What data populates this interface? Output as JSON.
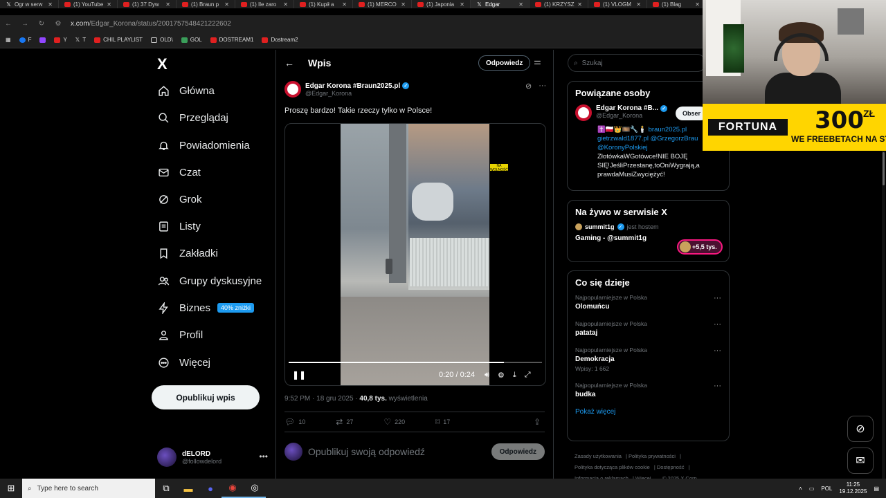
{
  "tabs": [
    {
      "label": "Ogr w serw",
      "icon": "x-icon",
      "active": false
    },
    {
      "label": "(1) YouTube",
      "icon": "youtube-icon",
      "active": false
    },
    {
      "label": "(1) 37 Dyw",
      "icon": "youtube-icon",
      "active": false
    },
    {
      "label": "(1) Braun p",
      "icon": "youtube-icon",
      "active": false
    },
    {
      "label": "(1) Ile zaro",
      "icon": "youtube-icon",
      "active": false
    },
    {
      "label": "(1) Kupił a",
      "icon": "youtube-icon",
      "active": false
    },
    {
      "label": "(1) MERCO",
      "icon": "youtube-icon",
      "active": false
    },
    {
      "label": "(1) Japonia",
      "icon": "youtube-icon",
      "active": false
    },
    {
      "label": "Edgar",
      "icon": "x-icon",
      "active": true
    },
    {
      "label": "(1) KRZYSZ",
      "icon": "youtube-icon",
      "active": false
    },
    {
      "label": "(1) VLOGM",
      "icon": "youtube-icon",
      "active": false
    },
    {
      "label": "(1) Blag",
      "icon": "youtube-icon",
      "active": false
    }
  ],
  "url": {
    "host": "x.com",
    "path": "/Edgar_Korona/status/2001757548421222602"
  },
  "bookmarks": [
    "F",
    "",
    "Y",
    "T",
    "CHIL PLAYLIST",
    "OLD\\",
    "GOL",
    "DOSTREAM1",
    "Dostream2"
  ],
  "sidebar": {
    "logo": "X",
    "items": [
      {
        "label": "Główna",
        "icon": "home-icon"
      },
      {
        "label": "Przeglądaj",
        "icon": "search-icon"
      },
      {
        "label": "Powiadomienia",
        "icon": "bell-icon"
      },
      {
        "label": "Czat",
        "icon": "mail-icon"
      },
      {
        "label": "Grok",
        "icon": "grok-icon"
      },
      {
        "label": "Listy",
        "icon": "list-icon"
      },
      {
        "label": "Zakładki",
        "icon": "bookmark-icon"
      },
      {
        "label": "Grupy dyskusyjne",
        "icon": "people-icon"
      },
      {
        "label": "Biznes",
        "icon": "bolt-icon",
        "badge": "40% zniżki"
      },
      {
        "label": "Profil",
        "icon": "person-icon"
      },
      {
        "label": "Więcej",
        "icon": "more-icon"
      }
    ],
    "post_button": "Opublikuj wpis",
    "account": {
      "name": "dELORD",
      "handle": "@followdelord"
    }
  },
  "main": {
    "header_title": "Wpis",
    "reply_button": "Odpowiedz",
    "author": {
      "name": "Edgar Korona #Braun2025.pl",
      "handle": "@Edgar_Korona"
    },
    "text": "Proszę bardzo! Takie rzeczy tylko w Polsce!",
    "video": {
      "time": "0:20 / 0:24",
      "progress": 0.85,
      "watermark": "w Polsce!",
      "sticker": "NA WOLNOŚĆ"
    },
    "meta": {
      "time": "9:52 PM · 18 gru 2025 · ",
      "views": "40,8 tys.",
      "views_label": "wyświetlenia"
    },
    "actions": {
      "replies": "10",
      "reposts": "27",
      "likes": "220",
      "bookmarks": "17"
    },
    "reply_placeholder": "Opublikuj swoją odpowiedź",
    "reply_submit": "Odpowiedz"
  },
  "right": {
    "search_placeholder": "Szukaj",
    "related": {
      "title": "Powiązane osoby",
      "name": "Edgar Korona #B...",
      "handle": "@Edgar_Korona",
      "follow": "Obser",
      "bio_flags": "✝️🇵🇱👑🎞️🔧🕯️",
      "bio_link1": "braun2025.pl",
      "bio_link2": "gietrzwald1877.pl @GrzegorzBrau",
      "bio_link3": "@KoronyPolskiej",
      "bio_text": "ZłotówkaWGotówce!NIE BOJĘ SIĘ!JeśliPrzestanę,toOniWygrają,a prawdaMusiZwyciężyć!"
    },
    "live": {
      "title": "Na żywo w serwisie X",
      "host_name": "summit1g",
      "host_suffix": "jest hostem",
      "stream_title": "Gaming - @summit1g",
      "viewers": "+5,5 tys."
    },
    "trends": {
      "title": "Co się dzieje",
      "items": [
        {
          "context": "Najpopularniejsze w Polska",
          "topic": "Olomuńcu",
          "posts": ""
        },
        {
          "context": "Najpopularniejsze w Polska",
          "topic": "patataj",
          "posts": ""
        },
        {
          "context": "Najpopularniejsze w Polska",
          "topic": "Demokracja",
          "posts": "Wpisy: 1 662"
        },
        {
          "context": "Najpopularniejsze w Polska",
          "topic": "budka",
          "posts": ""
        }
      ],
      "show_more": "Pokaż więcej"
    },
    "footer": [
      "Zasady użytkowania",
      "Polityka prywatności",
      "Polityka dotycząca plików cookie",
      "Dostępność",
      "Informacja o reklamach",
      "Więcej ...",
      "© 2025 X Corp."
    ]
  },
  "overlay": {
    "brand": "FORTUNA",
    "amount": "300",
    "currency": "ZŁ",
    "tagline": "WE FREEBETACH NA STAR"
  },
  "taskbar": {
    "search_placeholder": "Type here to search",
    "lang": "POL",
    "time": "11:25",
    "date": "19.12.2025"
  },
  "colors": {
    "accent": "#1d9bf0",
    "background": "#000000",
    "fortuna": "#ffd500",
    "live_pill": "#f91880"
  }
}
